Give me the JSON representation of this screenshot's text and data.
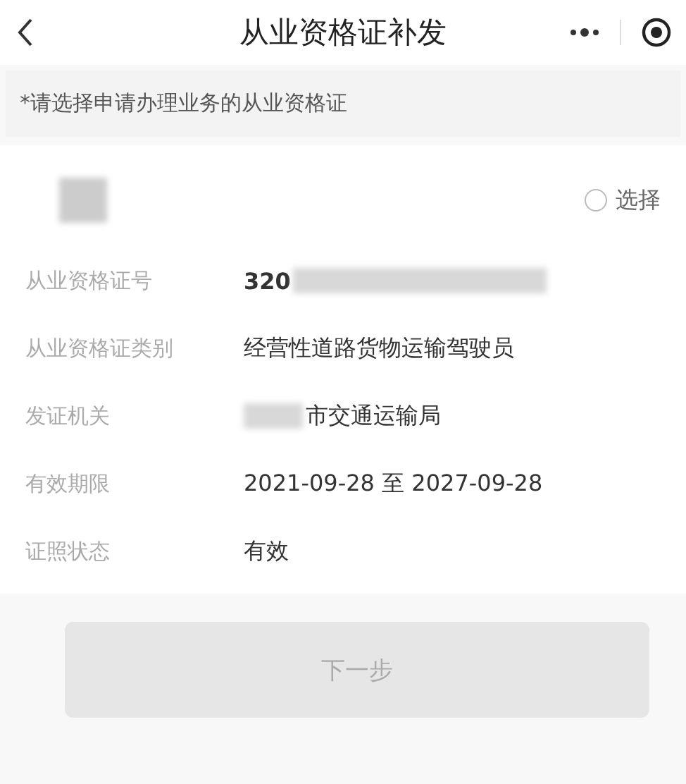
{
  "header": {
    "title": "从业资格证补发"
  },
  "notice": "*请选择申请办理业务的从业资格证",
  "card": {
    "holder_redacted": true,
    "select": {
      "label": "选择",
      "selected": false
    },
    "fields": [
      {
        "label": "从业资格证号",
        "value": "320",
        "blurred_before": false,
        "blurred_after": true,
        "bold": true
      },
      {
        "label": "从业资格证类别",
        "value": "经营性道路货物运输驾驶员",
        "blurred_before": false,
        "blurred_after": false,
        "bold": false
      },
      {
        "label": "发证机关",
        "value": "市交通运输局",
        "blurred_before": true,
        "blurred_after": false,
        "bold": false
      },
      {
        "label": "有效期限",
        "value": "2021-09-28 至 2027-09-28",
        "blurred_before": false,
        "blurred_after": false,
        "bold": false
      },
      {
        "label": "证照状态",
        "value": "有效",
        "blurred_before": false,
        "blurred_after": false,
        "bold": false
      }
    ]
  },
  "next_button": {
    "label": "下一步",
    "disabled": true
  }
}
